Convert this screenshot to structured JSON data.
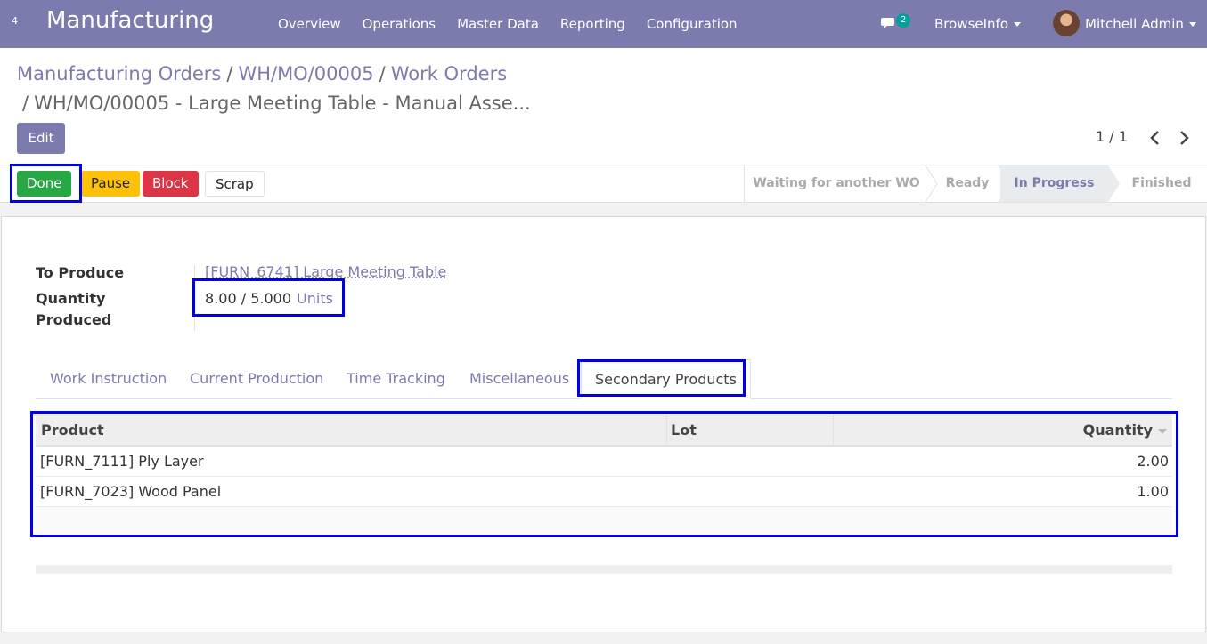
{
  "navbar": {
    "apps_badge": "4",
    "brand": "Manufacturing",
    "menu": [
      "Overview",
      "Operations",
      "Master Data",
      "Reporting",
      "Configuration"
    ],
    "chat_count": "2",
    "company": "BrowseInfo",
    "user": "Mitchell Admin",
    "bg_color": "#7c7bad"
  },
  "breadcrumb": {
    "items": [
      "Manufacturing Orders",
      "WH/MO/00005",
      "Work Orders"
    ],
    "current": "WH/MO/00005 - Large Meeting Table - Manual Asse..."
  },
  "control": {
    "edit_label": "Edit",
    "pager": "1 / 1"
  },
  "actions": {
    "done": "Done",
    "pause": "Pause",
    "block": "Block",
    "scrap": "Scrap"
  },
  "stages": [
    {
      "label": "Waiting for another WO",
      "active": false
    },
    {
      "label": "Ready",
      "active": false
    },
    {
      "label": "In Progress",
      "active": true
    },
    {
      "label": "Finished",
      "active": false
    }
  ],
  "form": {
    "to_produce_label": "To Produce",
    "to_produce_value": "[FURN_6741] Large Meeting Table",
    "qty_label_1": "Quantity",
    "qty_label_2": "Produced",
    "qty_produced": "8.00",
    "qty_sep": "/",
    "qty_total": "5.000",
    "qty_unit": "Units"
  },
  "tabs": [
    "Work Instruction",
    "Current Production",
    "Time Tracking",
    "Miscellaneous",
    "Secondary Products"
  ],
  "active_tab": "Secondary Products",
  "table": {
    "headers": {
      "product": "Product",
      "lot": "Lot",
      "quantity": "Quantity"
    },
    "rows": [
      {
        "product": "[FURN_7111] Ply Layer",
        "lot": "",
        "quantity": "2.00"
      },
      {
        "product": "[FURN_7023] Wood Panel",
        "lot": "",
        "quantity": "1.00"
      }
    ]
  },
  "colors": {
    "primary": "#7c7bad",
    "success": "#28a745",
    "warning": "#ffc107",
    "danger": "#dc3545",
    "highlight": "#0000e6"
  }
}
